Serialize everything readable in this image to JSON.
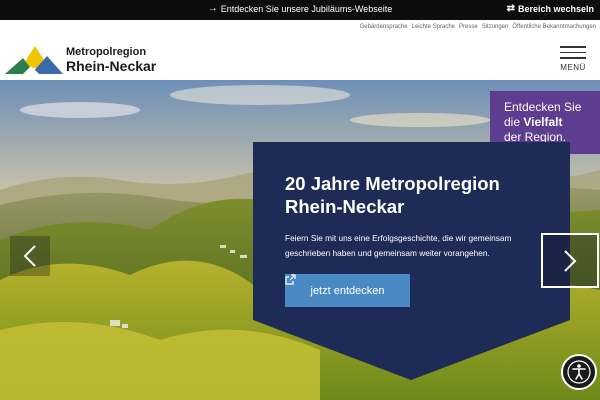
{
  "topbar": {
    "center_link": "Entdecken Sie unsere Jubiläums-Webseite",
    "right_link": "Bereich wechseln"
  },
  "utility_links": [
    "Gebärdensprache",
    "Leichte Sprache",
    "Presse",
    "Sitzungen",
    "Öffentliche Bekanntmachungen"
  ],
  "brand": {
    "line1": "Metropolregion",
    "line2": "Rhein-Neckar",
    "logo_colors": [
      "#f2c500",
      "#2e7d4f",
      "#3a6aa8"
    ]
  },
  "menu": {
    "label": "MENÜ"
  },
  "hero": {
    "teaser": {
      "line1": "Entdecken Sie",
      "line2_prefix": "die ",
      "line2_bold": "Vielfalt",
      "line3": "der Region."
    },
    "title": "20 Jahre Metropolregion Rhein-Neckar",
    "text": "Feiern Sie mit uns eine Erfolgsgeschichte, die wir gemeinsam geschrieben haben und gemeinsam weiter vorangehen.",
    "cta": "jetzt entdecken",
    "colors": {
      "panel": "#1f2b57",
      "teaser": "#5c3d8f",
      "cta": "#4a8ac4"
    }
  },
  "icons": {
    "topbar_arrow": "right-arrow-icon",
    "switch": "switch-arrows-icon",
    "menu": "hamburger-icon",
    "cta": "external-link-icon",
    "prev": "chevron-left-icon",
    "next": "chevron-right-icon",
    "a11y": "accessibility-icon"
  }
}
